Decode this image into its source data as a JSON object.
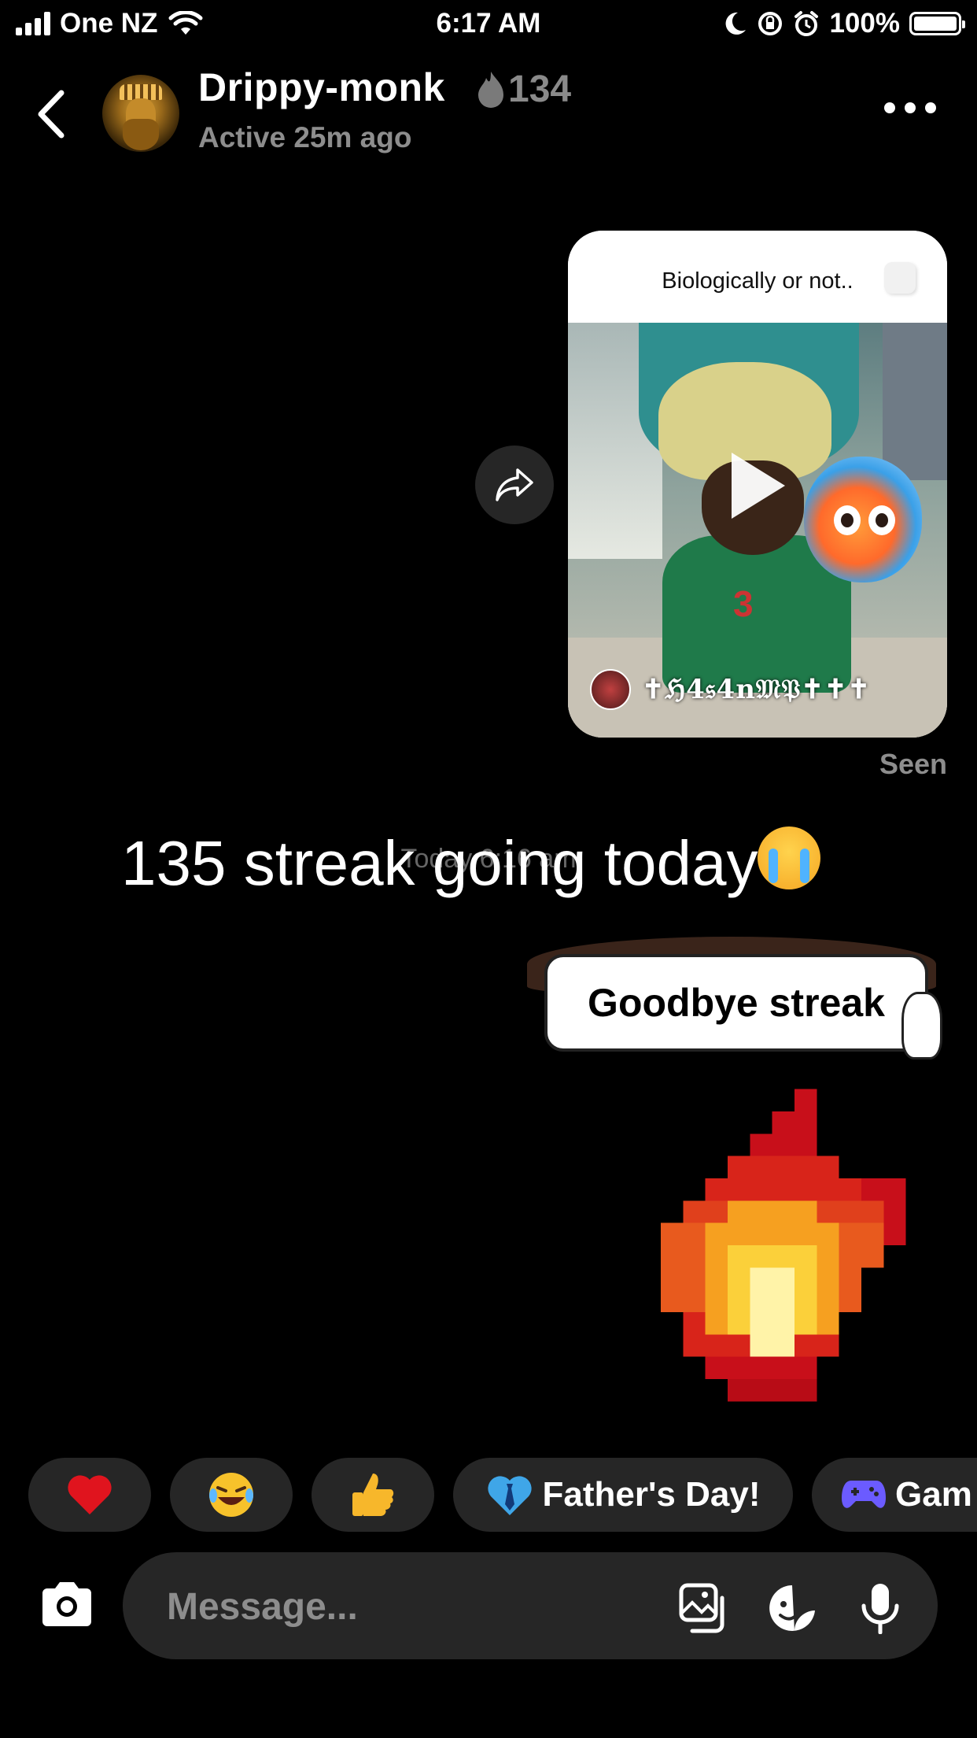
{
  "status_bar": {
    "carrier": "One NZ",
    "time": "6:17 AM",
    "battery": "100%"
  },
  "header": {
    "username": "Drippy-monk",
    "streak_count": "134",
    "active_status": "Active 25m ago"
  },
  "shared_post": {
    "caption": "Biologically or not..",
    "author": "✝ℌ4𝔰4n𝔐𝔓✝✝✝"
  },
  "seen_label": "Seen",
  "timestamp": "Today 6:16 am",
  "messages": {
    "big_text": "135 streak going today",
    "sticker_text": "Goodbye streak"
  },
  "quick_reactions": [
    {
      "label": "❤️",
      "icon": "heart-emoji"
    },
    {
      "label": "😂",
      "icon": "laughing-emoji"
    },
    {
      "label": "👍",
      "icon": "thumbs-up-emoji"
    },
    {
      "label": "Father's Day!",
      "icon": "blue-heart-tie-emoji"
    },
    {
      "label": "Gam",
      "icon": "gamepad-icon"
    }
  ],
  "composer": {
    "placeholder": "Message..."
  },
  "colors": {
    "background": "#000000",
    "bubble": "#262626",
    "muted_text": "#8d8d8d",
    "accent_game": "#6b5bff"
  }
}
